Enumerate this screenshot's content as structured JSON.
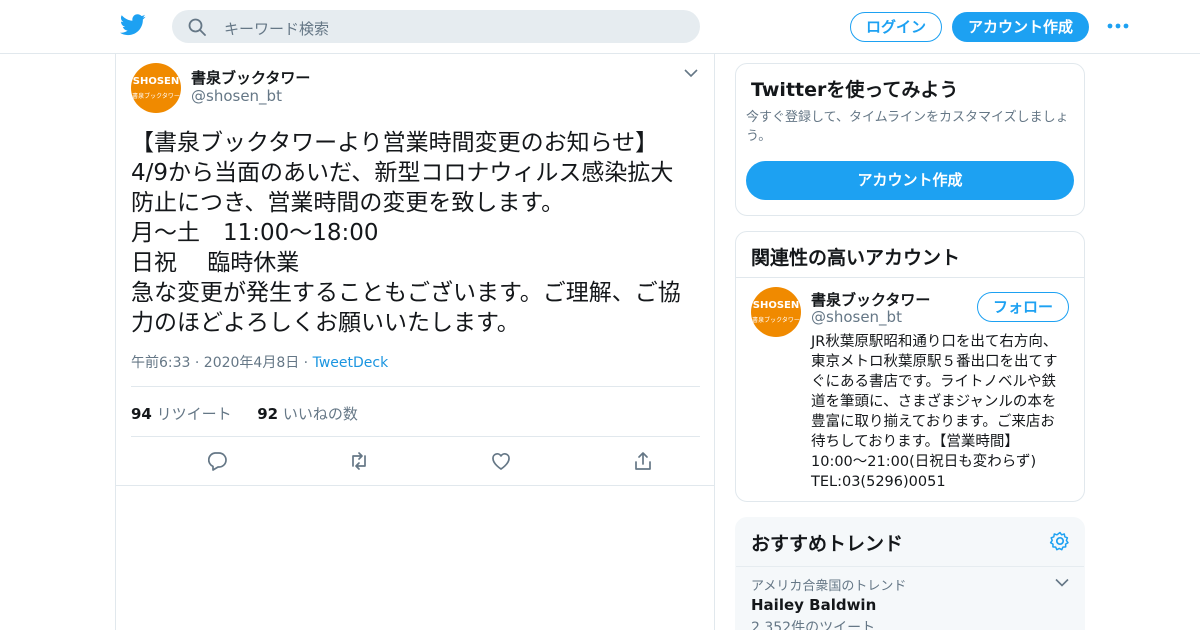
{
  "colors": {
    "accent": "#1da1f2",
    "link": "#1b95e0",
    "secondary_text": "#657786",
    "border": "#e1e8ed",
    "avatar_orange": "#f08a00"
  },
  "header": {
    "logo_icon": "twitter-bird-icon",
    "search": {
      "placeholder": "キーワード検索",
      "icon": "search-icon"
    },
    "login_label": "ログイン",
    "signup_label": "アカウント作成",
    "more_icon": "more-dots-icon"
  },
  "tweet": {
    "author": {
      "name": "書泉ブックタワー",
      "handle": "@shosen_bt",
      "avatar_text": "SHOSEN",
      "avatar_subtext": "書泉ブックタワー"
    },
    "text_lines": [
      "【書泉ブックタワーより営業時間変更のお知らせ】",
      "4/9から当面のあいだ、新型コロナウィルス感染拡大",
      "防止につき、営業時間の変更を致します。",
      "月〜土　11:00〜18:00",
      "日祝　 臨時休業",
      "急な変更が発生することもございます。ご理解、ご協",
      "力のほどよろしくお願いいたします。"
    ],
    "timestamp": "午前6:33 · 2020年4月8日 ·",
    "source": "TweetDeck",
    "retweets": {
      "count": "94",
      "label": "リツイート"
    },
    "likes": {
      "count": "92",
      "label": "いいねの数"
    },
    "actions": [
      "reply-icon",
      "retweet-icon",
      "like-icon",
      "share-icon"
    ]
  },
  "sidebar": {
    "signup_card": {
      "title": "Twitterを使ってみよう",
      "description": "今すぐ登録して、タイムラインをカスタマイズしましょう。",
      "button_label": "アカウント作成"
    },
    "related": {
      "title": "関連性の高いアカウント",
      "account": {
        "name": "書泉ブックタワー",
        "handle": "@shosen_bt",
        "follow_label": "フォロー",
        "avatar_text": "SHOSEN",
        "avatar_subtext": "書泉ブックタワー",
        "bio_lines": [
          "JR秋葉原駅昭和通り口を出て右方向、",
          "東京メトロ秋葉原駅５番出口を出てす",
          "ぐにある書店です。ライトノベルや鉄",
          "道を筆頭に、さまざまジャンルの本を",
          "豊富に取り揃えております。ご来店お",
          "待ちしております。【営業時間】",
          "10:00～21:00(日祝日も変わらず)",
          "TEL:03(5296)0051"
        ]
      }
    },
    "trends": {
      "title": "おすすめトレンド",
      "settings_icon": "gear-icon",
      "items": [
        {
          "context": "アメリカ合衆国のトレンド",
          "name": "Hailey Baldwin",
          "count": "2,352件のツイート"
        }
      ]
    }
  }
}
